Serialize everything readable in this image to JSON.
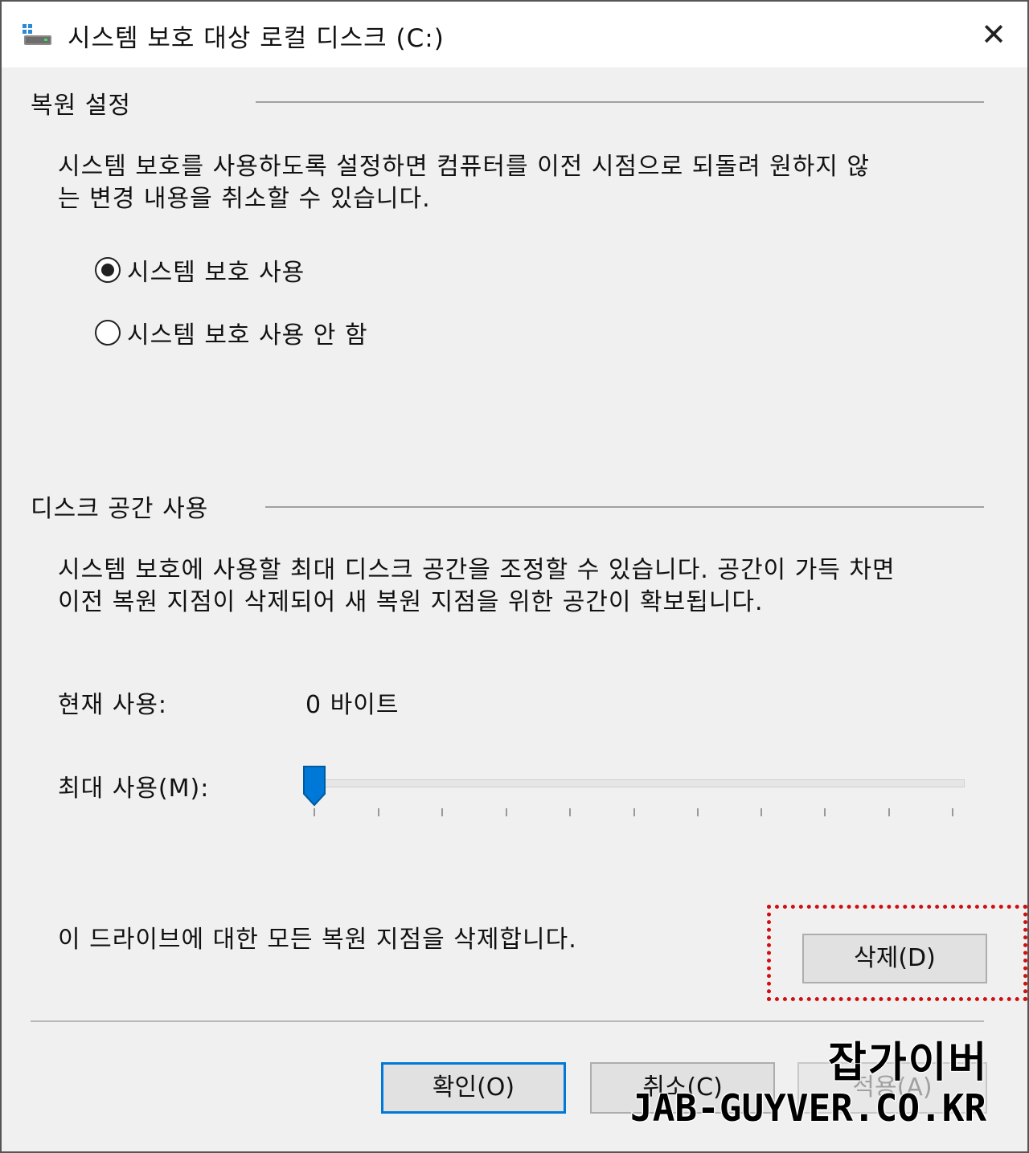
{
  "window": {
    "title": "시스템 보호 대상 로컬 디스크 (C:)",
    "close_glyph": "✕"
  },
  "restore_settings": {
    "heading": "복원 설정",
    "description_line1": "시스템 보호를 사용하도록 설정하면 컴퓨터를 이전 시점으로 되돌려 원하지 않",
    "description_line2": "는 변경 내용을 취소할 수 있습니다.",
    "options": [
      {
        "label": "시스템 보호 사용",
        "selected": true
      },
      {
        "label": "시스템 보호 사용 안 함",
        "selected": false
      }
    ]
  },
  "disk_space": {
    "heading": "디스크 공간 사용",
    "description_line1": "시스템 보호에 사용할 최대 디스크 공간을 조정할 수 있습니다. 공간이 가득 차면",
    "description_line2": "이전 복원 지점이 삭제되어 새 복원 지점을 위한 공간이 확보됩니다.",
    "current_usage_label": "현재 사용:",
    "current_usage_value": "0 바이트",
    "max_usage_label": "최대 사용(M):",
    "max_usage_slider_fraction": 0.0
  },
  "delete": {
    "description": "이 드라이브에 대한 모든 복원 지점을 삭제합니다.",
    "button_label": "삭제(D)"
  },
  "footer": {
    "ok_label": "확인(O)",
    "cancel_label": "취소(C)",
    "apply_label": "적용(A)"
  },
  "watermark": {
    "korean": "잡가이버",
    "url": "JAB-GUYVER.CO.KR"
  },
  "colors": {
    "accent": "#0078d7",
    "highlight": "#d01010",
    "background": "#f0f0f0"
  },
  "icons": {
    "app": "drive-icon",
    "close": "close-icon"
  }
}
